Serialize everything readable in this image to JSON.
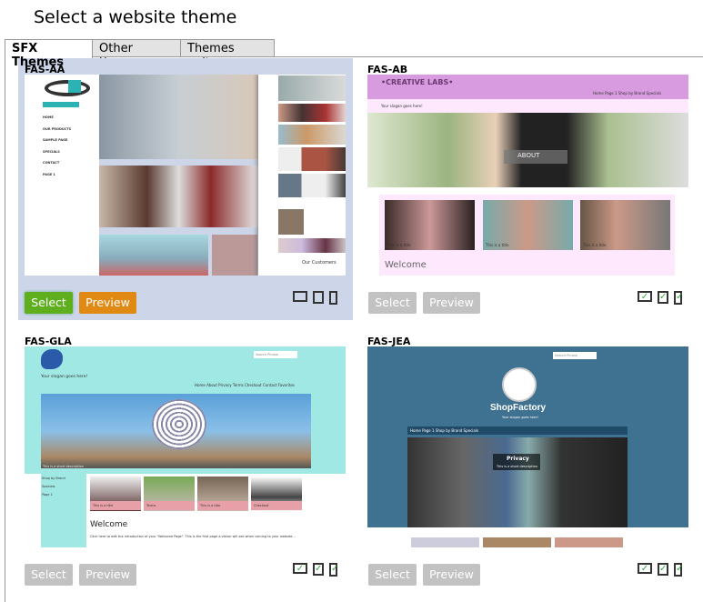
{
  "title": "Select a website theme",
  "tabs": [
    {
      "label": "SFX Themes",
      "active": true
    },
    {
      "label": "Other themes"
    },
    {
      "label": "Themes online"
    }
  ],
  "buttons": {
    "select": "Select",
    "preview": "Preview"
  },
  "colors": {
    "selected_card_bg": "#cdd6e8",
    "select_active": "#5fae1e",
    "preview_active": "#e08a14",
    "disabled": "#c2c2c2"
  },
  "device_icons": [
    "desktop-icon",
    "tablet-icon",
    "phone-icon"
  ],
  "themes": [
    {
      "name": "FAS-AA",
      "selected": true,
      "menu": [
        "HOME",
        "OUR PRODUCTS",
        "SAMPLE PAGE",
        "SPECIALS",
        "CONTACT",
        "PAGE 1"
      ],
      "customers": "Our Customers"
    },
    {
      "name": "FAS-AB",
      "logo": "•CREATIVE LABS•",
      "nav": "Home   Page 1   Shop by Brand   Specials",
      "slogan": "Your slogan goes here!",
      "hero": "ABOUT",
      "tiles": [
        "This is a title",
        "This is a title",
        "This is a title"
      ],
      "welcome": "Welcome"
    },
    {
      "name": "FAS-GLA",
      "search": "Search Phrase",
      "slogan": "Your slogan goes here!",
      "nav": "Home  About  Privacy  Terms  Checkout  Contact  Favorites",
      "caption": "This is a short description",
      "menu": [
        "Shop by Brand",
        "Specials",
        "Page 1"
      ],
      "tiles": [
        "This is a title",
        "Terms",
        "This is a title",
        "Checkout"
      ],
      "welcome": "Welcome",
      "intro": "Click here to edit the introduction of your \"Welcome Page\". This is the first page a visitor will see when coming to your website..."
    },
    {
      "name": "FAS-JEA",
      "search": "Search Phrase",
      "brand": "ShopFactory",
      "slogan": "Your slogan goes here!",
      "nav": "Home   Page 1   Shop by Brand   Specials",
      "hero": "Privacy",
      "hero_sub": "This is a short description"
    }
  ]
}
